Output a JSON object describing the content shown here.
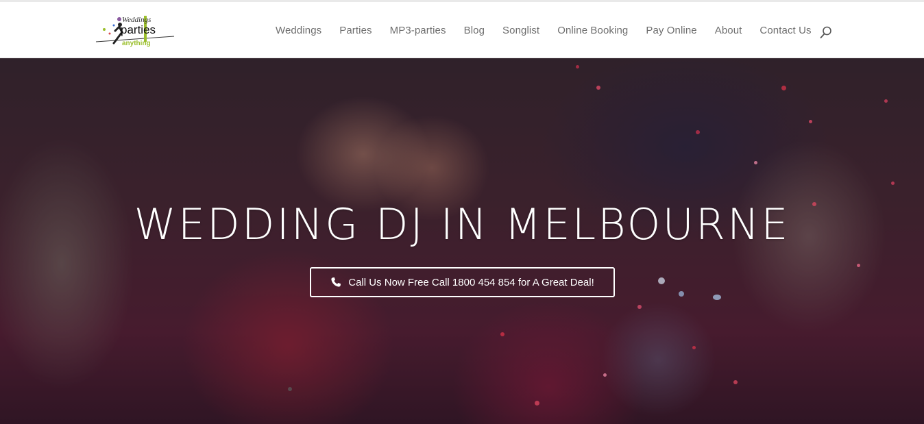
{
  "logo": {
    "line1": "Weddings",
    "line2": "parties",
    "line3": "anything",
    "accent_color": "#9bbf2c"
  },
  "nav": {
    "items": [
      {
        "label": "Weddings"
      },
      {
        "label": "Parties"
      },
      {
        "label": "MP3-parties"
      },
      {
        "label": "Blog"
      },
      {
        "label": "Songlist"
      },
      {
        "label": "Online Booking"
      },
      {
        "label": "Pay Online"
      },
      {
        "label": "About"
      },
      {
        "label": "Contact Us"
      }
    ],
    "search_icon": "search-icon"
  },
  "hero": {
    "title": "WEDDING DJ IN MELBOURNE",
    "cta_label": "Call Us Now Free Call 1800 454 854 for A Great Deal!",
    "cta_icon": "phone-icon"
  },
  "colors": {
    "nav_text": "#6e6e6e",
    "hero_text": "#ffffff"
  }
}
